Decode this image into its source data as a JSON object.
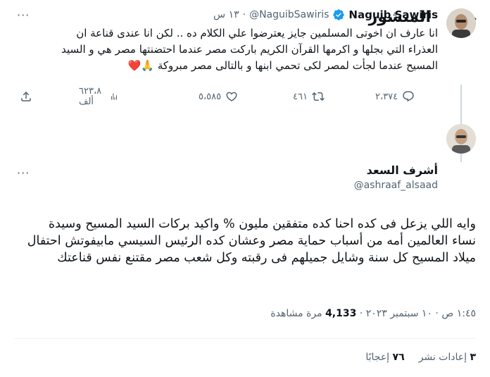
{
  "header": {
    "title": "المنشور",
    "back_label": "back"
  },
  "parent_tweet": {
    "name": "Naguib Sawiris",
    "handle": "@NaguibSawiris",
    "time": "١٣ س",
    "text": "انا عارف ان اخوتى المسلمين جايز يعترضوا علي الكلام ده .. لكن انا عندى قناعة ان العذراء التي بجلها و اكرمها القرآن الكريم باركت مصر عندما احتضنتها مصر هي و السيد المسيح عندما لجأت لمصر لكى تحمي ابنها و بالتالى مصر مبروكة 🙏❤️",
    "replies": "٢،٣٧٤",
    "retweets": "٤٦١",
    "likes": "٥،٥٨٥",
    "views": "٦٢٣،٨ ألف"
  },
  "main_tweet": {
    "name": "أشرف السعد",
    "handle": "@ashraaf_alsaad",
    "text": "وايه اللي يزعل فى كده احنا كده متفقين مليون % واكيد بركات السيد المسيح وسيدة نساء العالمين أمه من أسباب حماية مصر وعشان كده الرئيس السيسي مابيفوتش احتفال ميلاد المسيح كل سنة وشايل جميلهم فى رقبته وكل شعب مصر مقتنع نفس قناعتك",
    "time": "١:٤٥ ص",
    "date": "١٠ سبتمبر ٢٠٢٣",
    "views_count": "4,133",
    "views_label": "مرة مشاهدة",
    "retweets_count": "٣",
    "retweets_label": "إعادات نشر",
    "likes_count": "٧٦",
    "likes_label": "إعجابًا"
  },
  "colors": {
    "verified": "#1d9bf0",
    "like": "#f91880",
    "secondary_text": "#536471"
  }
}
